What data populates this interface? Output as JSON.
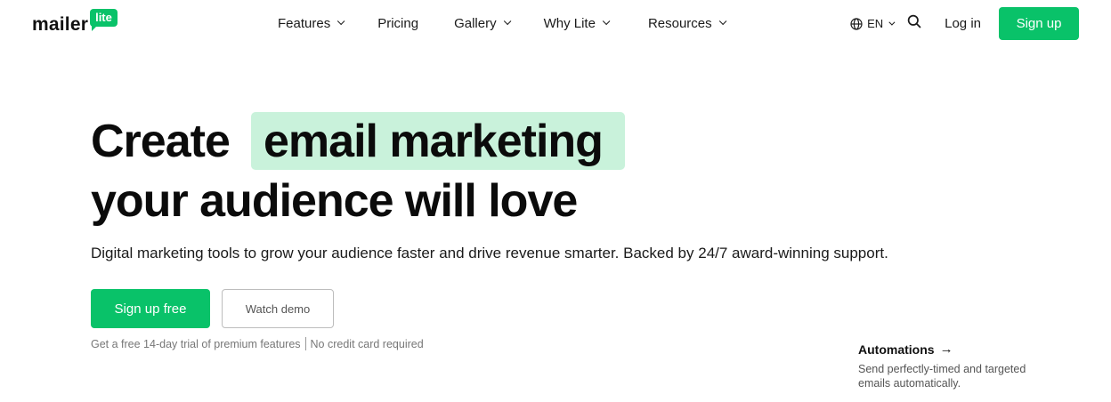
{
  "brand": {
    "name": "mailer",
    "badge": "lite",
    "accent": "#09c269",
    "highlight": "#c9f2db"
  },
  "nav": {
    "features": "Features",
    "pricing": "Pricing",
    "gallery": "Gallery",
    "why": "Why Lite",
    "resources": "Resources"
  },
  "header": {
    "language": "EN",
    "login": "Log in",
    "signup": "Sign up"
  },
  "hero": {
    "line1_prefix": "Create",
    "line1_highlight": "email marketing",
    "line2": "your audience will love",
    "subtitle": "Digital marketing tools to grow your audience faster and drive revenue smarter. Backed by 24/7 award-winning support.",
    "primary_cta": "Sign up free",
    "secondary_cta": "Watch demo",
    "note_left": "Get a free 14-day trial of premium features",
    "note_right": "No credit card required"
  },
  "feature_card": {
    "title": "Automations",
    "arrow": "→",
    "description": "Send perfectly-timed and targeted emails automatically."
  },
  "icons": {
    "globe": "globe-icon",
    "search": "search-icon",
    "chevron": "chevron-down-icon"
  }
}
